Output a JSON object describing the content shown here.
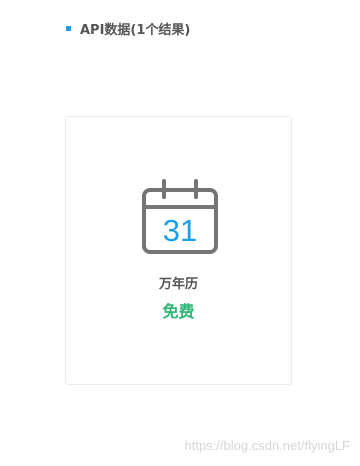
{
  "section": {
    "title": "API数据(1个结果)",
    "bullet_color": "#1aa0e8"
  },
  "api_card": {
    "icon": "calendar-icon",
    "calendar_day": "31",
    "icon_color": "#757575",
    "day_color": "#1aa0e8",
    "name": "万年历",
    "price": "免费",
    "price_color": "#2bb673"
  },
  "watermark": "https://blog.csdn.net/flyingLF"
}
